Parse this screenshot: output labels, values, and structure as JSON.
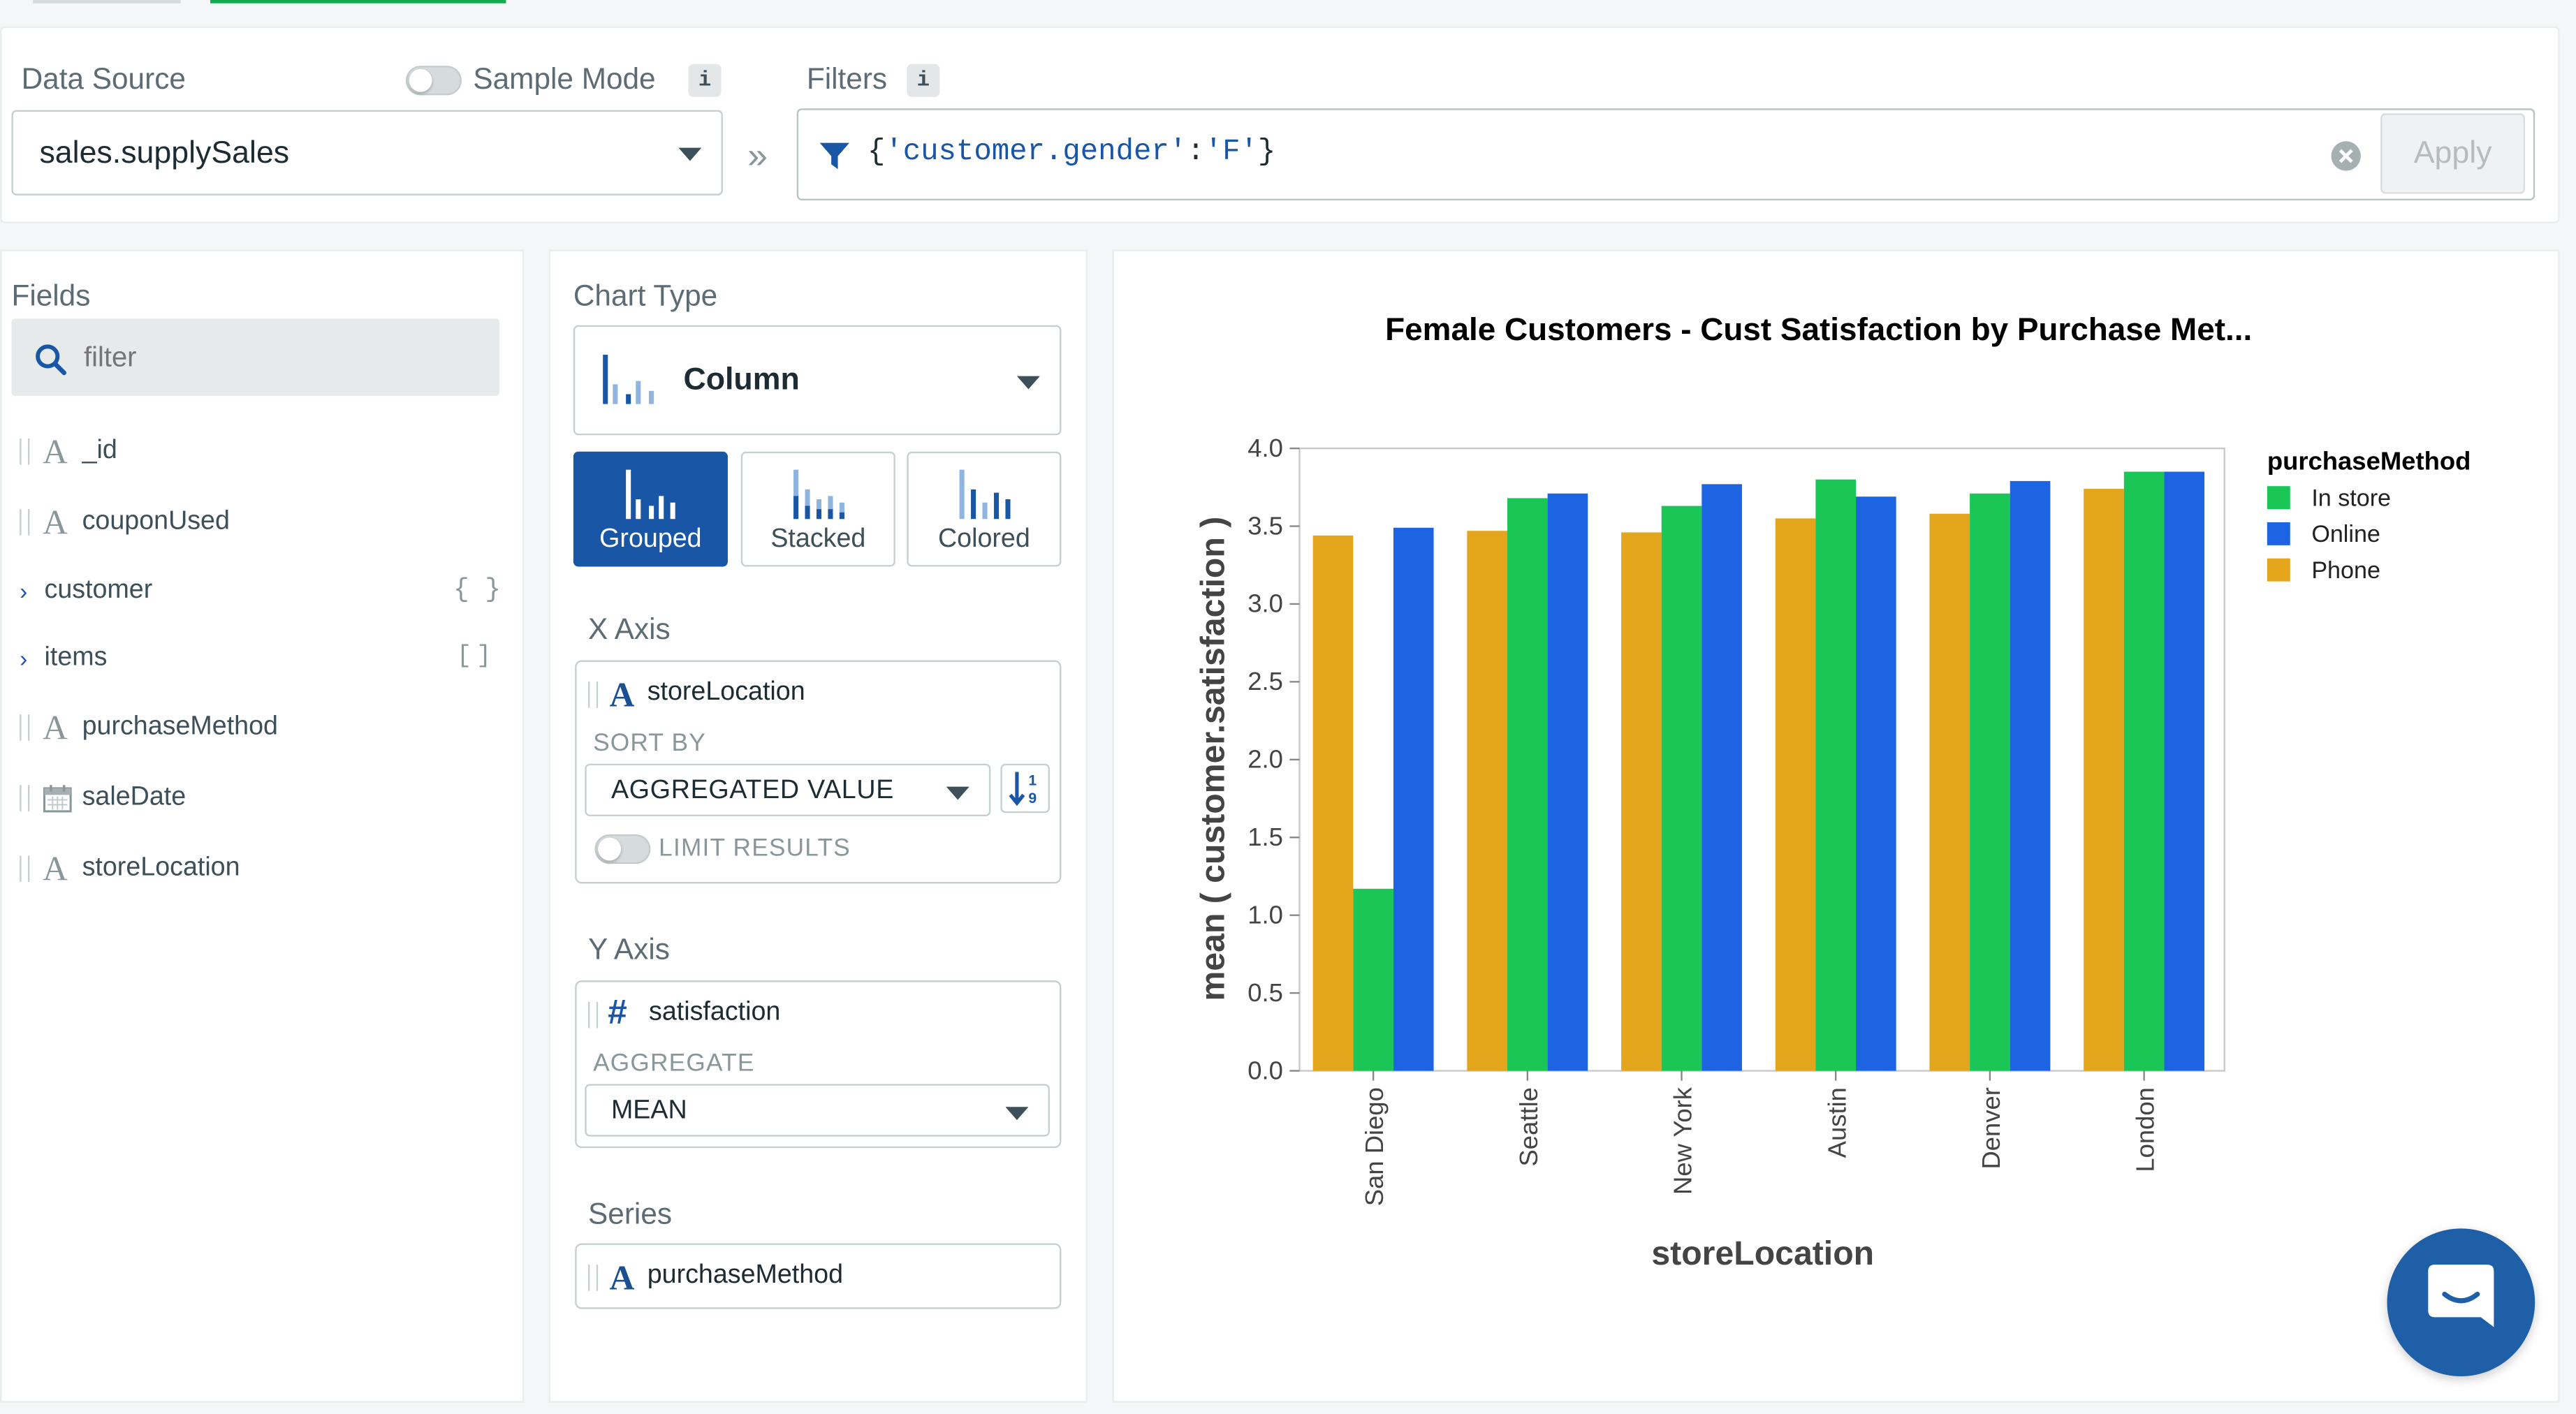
{
  "topbar": {
    "tab_underline_color": "#13aa52"
  },
  "datasource": {
    "label": "Data Source",
    "value": "sales.supplySales",
    "sample_mode_label": "Sample Mode",
    "info_glyph": "i"
  },
  "filters": {
    "label": "Filters",
    "info_glyph": "i",
    "query_open": "{",
    "query_key": "'customer.gender'",
    "query_colon": ":",
    "query_value": "'F'",
    "query_close": "}",
    "apply_label": "Apply",
    "arrow_glyph": "»"
  },
  "fields": {
    "title": "Fields",
    "search_placeholder": "filter",
    "items": [
      {
        "name": "_id",
        "type": "string-icon"
      },
      {
        "name": "couponUsed",
        "type": "string-icon"
      },
      {
        "name": "customer",
        "type": "object-icon",
        "badge": "{ }"
      },
      {
        "name": "items",
        "type": "array-icon",
        "badge": "[ ]"
      },
      {
        "name": "purchaseMethod",
        "type": "string-icon"
      },
      {
        "name": "saleDate",
        "type": "date-icon"
      },
      {
        "name": "storeLocation",
        "type": "string-icon"
      }
    ]
  },
  "encoding": {
    "chart_type_label": "Chart Type",
    "chart_type_value": "Column",
    "variants": [
      "Grouped",
      "Stacked",
      "Colored"
    ],
    "x_axis": {
      "title": "X Axis",
      "field": "storeLocation",
      "sort_by_label": "SORT BY",
      "sort_by_value": "AGGREGATED VALUE",
      "limit_label": "LIMIT RESULTS"
    },
    "y_axis": {
      "title": "Y Axis",
      "field": "satisfaction",
      "aggregate_label": "AGGREGATE",
      "aggregate_value": "MEAN"
    },
    "series": {
      "title": "Series",
      "field": "purchaseMethod"
    }
  },
  "chart_data": {
    "type": "bar",
    "title": "Female Customers - Cust Satisfaction by Purchase Met...",
    "xlabel": "storeLocation",
    "ylabel": "mean ( customer.satisfaction )",
    "categories": [
      "San Diego",
      "Seattle",
      "New York",
      "Austin",
      "Denver",
      "London"
    ],
    "ylim": [
      0,
      4
    ],
    "yticks": [
      "0.0",
      "0.5",
      "1.0",
      "1.5",
      "2.0",
      "2.5",
      "3.0",
      "3.5",
      "4.0"
    ],
    "legend_title": "purchaseMethod",
    "legend_position": "right",
    "series": [
      {
        "name": "Phone",
        "color": "#e3a51c",
        "values": [
          3.44,
          3.47,
          3.46,
          3.55,
          3.58,
          3.74
        ]
      },
      {
        "name": "In store",
        "color": "#1ac655",
        "values": [
          1.17,
          3.68,
          3.63,
          3.8,
          3.71,
          3.85
        ]
      },
      {
        "name": "Online",
        "color": "#1d64e2",
        "values": [
          3.49,
          3.71,
          3.77,
          3.69,
          3.79,
          3.85
        ]
      }
    ],
    "legend_order": [
      "In store",
      "Online",
      "Phone"
    ]
  }
}
